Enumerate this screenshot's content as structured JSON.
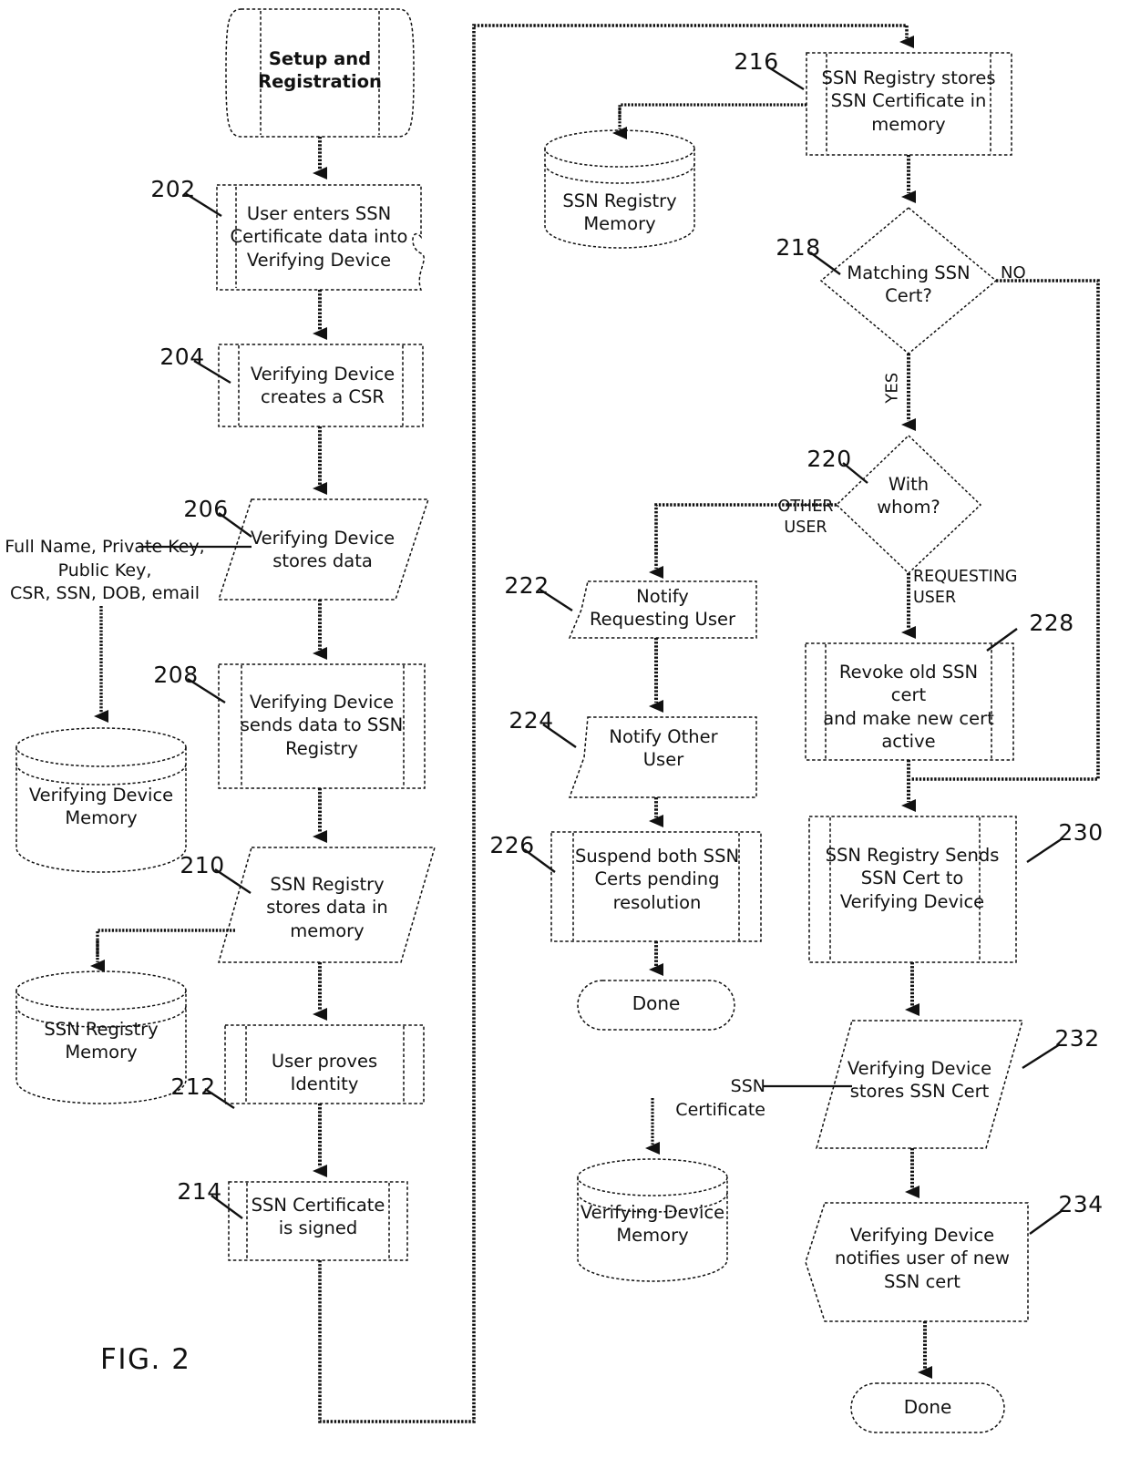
{
  "figure": {
    "label": "FIG. 2",
    "title": "Setup and Registration"
  },
  "terminators": {
    "start": {
      "text": "Setup and\nRegistration"
    },
    "done_middle": {
      "text": "Done"
    },
    "done_right": {
      "text": "Done"
    }
  },
  "datastores": [
    {
      "id": "vd-mem-left",
      "text": "Verifying Device\nMemory"
    },
    {
      "id": "ssn-reg-mem-left",
      "text": "SSN Registry\nMemory"
    },
    {
      "id": "ssn-reg-mem-right",
      "text": "SSN Registry\nMemory"
    },
    {
      "id": "vd-mem-bottom",
      "text": "Verifying Device\nMemory"
    }
  ],
  "annotations": [
    {
      "id": "data-fields",
      "text": "Full Name, Private Key,\nPublic Key,\nCSR, SSN, DOB, email"
    },
    {
      "id": "ssn-certificate-tag",
      "text": "SSN Certificate"
    }
  ],
  "edge_labels": {
    "no": "NO",
    "yes": "YES",
    "other_user": "OTHER\nUSER",
    "requesting_user": "REQUESTING\nUSER"
  },
  "steps": [
    {
      "ref": "202",
      "text": "User enters SSN\nCertificate data into\nVerifying Device",
      "shape": "document"
    },
    {
      "ref": "204",
      "text": "Verifying Device\ncreates a  CSR",
      "shape": "predefined-process"
    },
    {
      "ref": "206",
      "text": "Verifying Device\nstores data",
      "shape": "parallelogram"
    },
    {
      "ref": "208",
      "text": "Verifying Device\nsends data to SSN\nRegistry",
      "shape": "predefined-process"
    },
    {
      "ref": "210",
      "text": "SSN Registry\nstores data in\nmemory",
      "shape": "parallelogram"
    },
    {
      "ref": "212",
      "text": "User proves\nIdentity",
      "shape": "predefined-process"
    },
    {
      "ref": "214",
      "text": "SSN Certificate\nis signed",
      "shape": "predefined-process"
    },
    {
      "ref": "216",
      "text": "SSN Registry stores\nSSN Certificate in\nmemory",
      "shape": "predefined-process"
    },
    {
      "ref": "218",
      "text": "Matching SSN\nCert?",
      "shape": "decision"
    },
    {
      "ref": "220",
      "text": "With\nwhom?",
      "shape": "decision"
    },
    {
      "ref": "222",
      "text": "Notify\nRequesting User",
      "shape": "document-left"
    },
    {
      "ref": "224",
      "text": "Notify Other\nUser",
      "shape": "document-left"
    },
    {
      "ref": "226",
      "text": "Suspend both SSN\nCerts pending\nresolution",
      "shape": "predefined-process"
    },
    {
      "ref": "228",
      "text": "Revoke old SSN cert\nand make new cert\nactive",
      "shape": "predefined-process"
    },
    {
      "ref": "230",
      "text": "SSN Registry Sends\nSSN Cert to\nVerifying Device",
      "shape": "predefined-process"
    },
    {
      "ref": "232",
      "text": "Verifying Device\nstores SSN Cert",
      "shape": "parallelogram"
    },
    {
      "ref": "234",
      "text": "Verifying Device\nnotifies user of new\nSSN cert",
      "shape": "document-left"
    }
  ],
  "colors": {
    "ink": "#111111",
    "background": "#ffffff"
  }
}
